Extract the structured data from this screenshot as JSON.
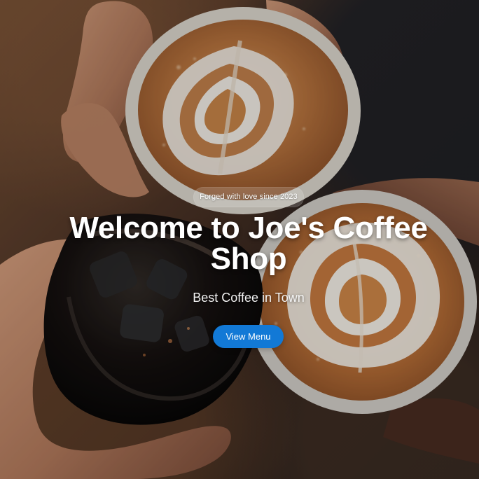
{
  "hero": {
    "badge": "Forged with love since 2023",
    "title": "Welcome to Joe's Coffee Shop",
    "subtitle": "Best Coffee in Town",
    "cta": "View Menu"
  },
  "colors": {
    "primary_button": "#1279d6",
    "text": "#ffffff"
  }
}
